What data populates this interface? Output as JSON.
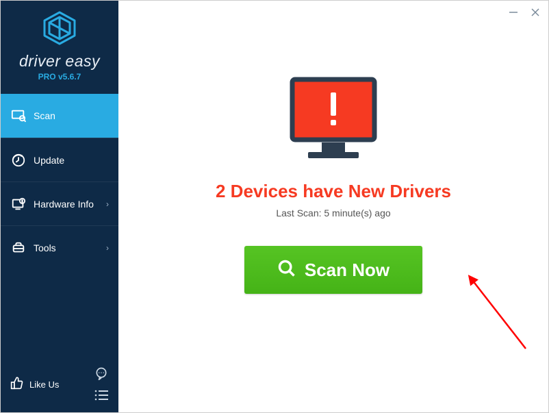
{
  "brand": {
    "name": "driver easy",
    "version": "PRO v5.6.7"
  },
  "sidebar": {
    "items": [
      {
        "label": "Scan"
      },
      {
        "label": "Update"
      },
      {
        "label": "Hardware Info"
      },
      {
        "label": "Tools"
      }
    ],
    "likeus_label": "Like Us"
  },
  "main": {
    "headline": "2 Devices have New Drivers",
    "last_scan": "Last Scan: 5 minute(s) ago",
    "scan_button_label": "Scan Now"
  },
  "colors": {
    "accent": "#29abe2",
    "alert": "#f63a22",
    "action": "#4cb71c"
  }
}
